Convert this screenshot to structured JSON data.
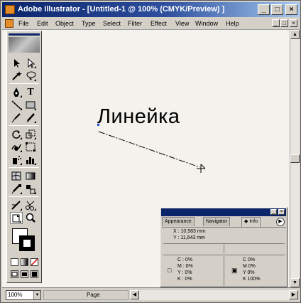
{
  "window": {
    "title": "Adobe Illustrator - [Untitled-1 @ 100% (CMYK/Preview) ]",
    "controls": {
      "minimize": "_",
      "maximize": "□",
      "close": "×"
    },
    "mdi_controls": {
      "minimize": "_",
      "restore": "□",
      "close": "×"
    }
  },
  "menu": [
    "File",
    "Edit",
    "Object",
    "Type",
    "Select",
    "Filter",
    "Effect",
    "View",
    "Window",
    "Help"
  ],
  "artwork": {
    "text": "Линейка"
  },
  "toolbox": {
    "tools": [
      "selection-tool",
      "direct-selection-tool",
      "magic-wand-tool",
      "lasso-tool",
      "pen-tool",
      "type-tool",
      "line-tool",
      "rectangle-tool",
      "paintbrush-tool",
      "pencil-tool",
      "rotate-tool",
      "scale-tool",
      "warp-tool",
      "free-transform-tool",
      "symbol-sprayer-tool",
      "graph-tool",
      "mesh-tool",
      "gradient-tool",
      "eyedropper-tool",
      "blend-tool",
      "slice-tool",
      "scissors-tool",
      "hand-tool",
      "zoom-tool"
    ],
    "type_glyph": "T"
  },
  "status": {
    "zoom": "100%",
    "page_label": "Page"
  },
  "info_panel": {
    "tabs": [
      "Appearance",
      "Navigator",
      "Info"
    ],
    "x": "X : 10,583 mm",
    "y": "Y : 11,643 mm",
    "left_cmyk": {
      "c": "C : 0%",
      "m": "M : 0%",
      "y": "Y : 0%",
      "k": "K : 0%"
    },
    "right_cmyk": {
      "c": "C  0%",
      "m": "M  0%",
      "y": "Y  0%",
      "k": "K  100%"
    }
  },
  "colors": {
    "titlebar_start": "#0a246a",
    "titlebar_end": "#a6caf0",
    "chrome": "#d4d0c8",
    "canvas": "#f4f2ec"
  }
}
